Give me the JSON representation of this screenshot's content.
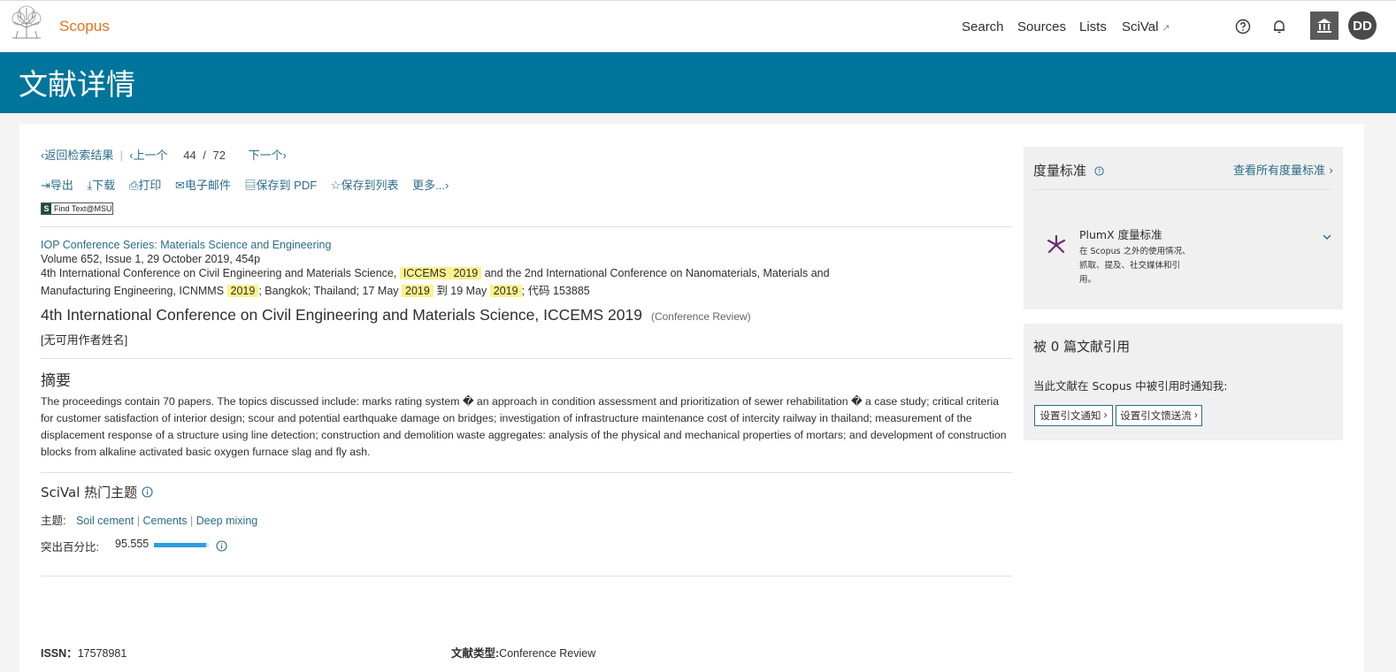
{
  "brand": {
    "name": "Scopus"
  },
  "nav": {
    "search": "Search",
    "sources": "Sources",
    "lists": "Lists",
    "scival": "SciVal",
    "scival_ext": "↗"
  },
  "user": {
    "initials": "DD"
  },
  "header": {
    "title": "文献详情"
  },
  "doc_nav": {
    "back": "返回检索结果",
    "prev": "上一个",
    "current": "44",
    "slash": "/",
    "total": "72",
    "next": "下一个"
  },
  "actions": {
    "export": "导出",
    "download": "下载",
    "print": "打印",
    "email": "电子邮件",
    "save_pdf": "保存到 PDF",
    "save_list": "保存到列表",
    "more": "更多..."
  },
  "findtext": {
    "s": "S",
    "label": "Find Text@MSU"
  },
  "source": {
    "journal": "IOP Conference Series: Materials Science and Engineering",
    "volume": "Volume 652, Issue 1, 29 October 2019, 454p",
    "conf_a": "4th International Conference on Civil Engineering and Materials Science,",
    "hl_iccems": "ICCEMS",
    "hl_2019": "2019",
    "conf_b": "and the 2nd International Conference on Nanomaterials, Materials and",
    "conf_c": "Manufacturing Engineering, ICNMMS",
    "conf_d": "; Bangkok; Thailand; 17 May",
    "conf_e": "到 19 May",
    "conf_f": "; 代码 153885"
  },
  "document": {
    "title": "4th International Conference on Civil Engineering and Materials Science, ICCEMS 2019",
    "type": "(Conference Review)",
    "authors": "[无可用作者姓名]"
  },
  "abstract": {
    "heading": "摘要",
    "text": "The proceedings contain 70 papers. The topics discussed include: marks rating system � an approach in condition assessment and prioritization of sewer rehabilitation � a case study; critical criteria for customer satisfaction of interior design; scour and potential earthquake damage on bridges; investigation of infrastructure maintenance cost of intercity railway in thailand; measurement of the displacement response of a structure using line detection; construction and demolition waste aggregates: analysis of the physical and mechanical properties of mortars; and development of construction blocks from alkaline activated basic oxygen furnace slag and fly ash."
  },
  "scival": {
    "heading": "SciVal 热门主题",
    "topic_label": "主题:",
    "topics": [
      "Soil cement",
      "Cements",
      "Deep mixing"
    ],
    "prominence_label": "突出百分比:",
    "prominence_value": "95.555",
    "prominence_fraction": 0.95555
  },
  "footer": {
    "issn_label": "ISSN：",
    "issn": "17578981",
    "doctype_label": "文献类型:",
    "doctype": "Conference Review"
  },
  "metrics": {
    "heading": "度量标准",
    "view_all": "查看所有度量标准",
    "plumx_title": "PlumX 度量标准",
    "plumx_desc_1": "在 Scopus 之外的使用情况、",
    "plumx_desc_2": "抓取、提及、社交媒体和引",
    "plumx_desc_3": "用。"
  },
  "cited": {
    "heading": "被 0 篇文献引用",
    "notify": "当此文献在 Scopus 中被引用时通知我:",
    "btn_alert": "设置引文通知",
    "btn_feed": "设置引文馈送流"
  },
  "colors": {
    "brand_orange": "#e9711c",
    "header_blue": "#00759b",
    "link": "#2b6c8a",
    "highlight": "#fbf28c"
  }
}
